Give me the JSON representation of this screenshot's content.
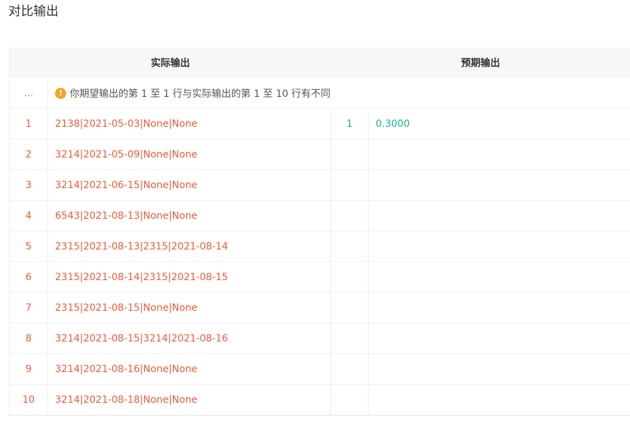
{
  "title": "对比输出",
  "headers": {
    "actual": "实际输出",
    "expected": "预期输出"
  },
  "notice": {
    "index": "...",
    "icon": "warning-icon",
    "icon_glyph": "!",
    "text": "你期望输出的第 1 至 1 行与实际输出的第 1 至 10 行有不同"
  },
  "rows": [
    {
      "num": "1",
      "actual": "2138|2021-05-03|None|None",
      "exp_num": "1",
      "expected": "0.3000"
    },
    {
      "num": "2",
      "actual": "3214|2021-05-09|None|None",
      "exp_num": "",
      "expected": ""
    },
    {
      "num": "3",
      "actual": "3214|2021-06-15|None|None",
      "exp_num": "",
      "expected": ""
    },
    {
      "num": "4",
      "actual": "6543|2021-08-13|None|None",
      "exp_num": "",
      "expected": ""
    },
    {
      "num": "5",
      "actual": "2315|2021-08-13|2315|2021-08-14",
      "exp_num": "",
      "expected": ""
    },
    {
      "num": "6",
      "actual": "2315|2021-08-14|2315|2021-08-15",
      "exp_num": "",
      "expected": ""
    },
    {
      "num": "7",
      "actual": "2315|2021-08-15|None|None",
      "exp_num": "",
      "expected": ""
    },
    {
      "num": "8",
      "actual": "3214|2021-08-15|3214|2021-08-16",
      "exp_num": "",
      "expected": ""
    },
    {
      "num": "9",
      "actual": "3214|2021-08-16|None|None",
      "exp_num": "",
      "expected": ""
    },
    {
      "num": "10",
      "actual": "3214|2021-08-18|None|None",
      "exp_num": "",
      "expected": ""
    }
  ],
  "colors": {
    "diff_red": "#f05a3a",
    "match_green": "#1ab394",
    "warning_orange": "#f5a623"
  }
}
